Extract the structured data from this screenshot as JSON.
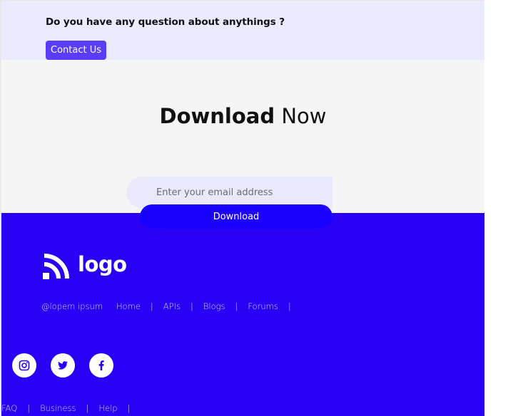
{
  "top_banner": {
    "question": "Do you have any question about anythings ?",
    "contact_label": "Contact Us"
  },
  "download": {
    "title_bold": "Download",
    "title_rest": "Now",
    "email_placeholder": "Enter your email address",
    "button_label": "Download"
  },
  "footer": {
    "logo_text": "logo",
    "links": [
      "@lopem ipsum",
      "Home",
      "APIs",
      "Blogs",
      "Forums"
    ],
    "separator": "|",
    "social_icons": [
      "instagram-icon",
      "twitter-icon",
      "facebook-icon"
    ],
    "bottom_links": [
      "FAQ",
      "Business",
      "Help"
    ]
  },
  "colors": {
    "accent": "#5a3df6",
    "footer_bg": "#2a00f5",
    "download_button": "#1a00ff",
    "top_strip_bg": "#ebebff"
  }
}
